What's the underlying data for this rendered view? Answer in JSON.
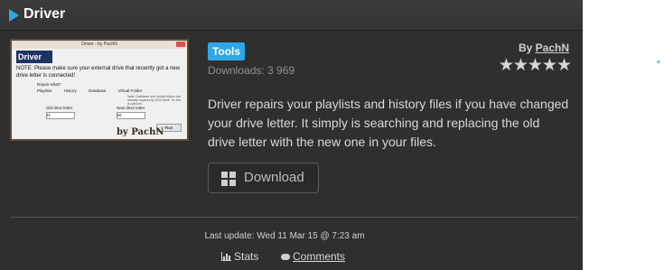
{
  "header": {
    "title": "Driver"
  },
  "thumbnail": {
    "window_title": "Driver - by PachN",
    "logo_text": "Driver",
    "note": "NOTE: Please make sure your external drive that recently got a new drive letter is connected!",
    "repair_label": "Repair what?",
    "options": [
      "Playlists",
      "History",
      "Database",
      "Virtual Folder"
    ],
    "tiny_note": "Note: Database and virtual folders are already repaired by VOX itself. So this is optional.",
    "old_drive_label": "Old drive letter",
    "new_drive_label": "New drive letter",
    "old_drive_value": "H:",
    "new_drive_value": "M:",
    "run_label": "Run",
    "signature": "by PachN"
  },
  "tag": {
    "label": "Tools"
  },
  "downloads": "Downloads: 3 969",
  "author": {
    "prefix": "By",
    "name": "PachN"
  },
  "rating": {
    "stars": 5,
    "max": 5,
    "display": "★★★★★"
  },
  "description": "Driver repairs your playlists and history files if you have changed your drive letter. It simply is searching and replacing the old drive letter with the new one in your files.",
  "download_button": {
    "label": "Download"
  },
  "last_update": "Last update: Wed 11 Mar 15 @ 7:23 am",
  "footer": {
    "stats_label": "Stats",
    "comments_label": "Comments"
  },
  "colors": {
    "accent": "#2fa6e6",
    "panel": "#2f2f2f",
    "text": "#d9d9d9"
  }
}
